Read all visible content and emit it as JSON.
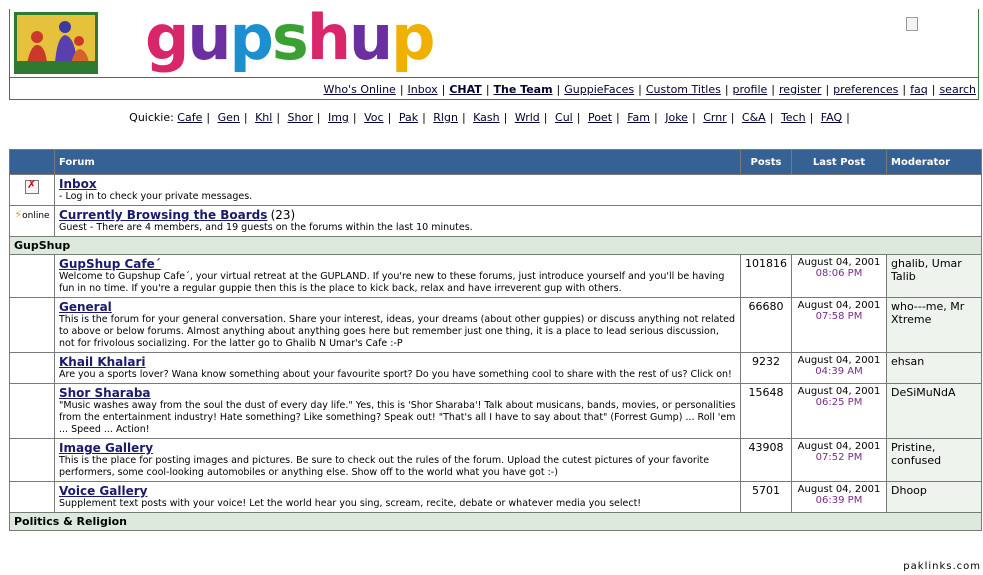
{
  "brand": {
    "name": "gupshup",
    "letter_colors": [
      "#d9266b",
      "#6c2fa0",
      "#1b8fd0",
      "#3aa033",
      "#d9266b",
      "#6c2fa0",
      "#f0b000"
    ]
  },
  "top_links": [
    {
      "label": "Who's Online",
      "bold": false
    },
    {
      "label": "Inbox",
      "bold": false
    },
    {
      "label": "CHAT",
      "bold": true
    },
    {
      "label": "The Team",
      "bold": true
    },
    {
      "label": "GuppieFaces",
      "bold": false
    },
    {
      "label": "Custom Titles",
      "bold": false
    },
    {
      "label": "profile",
      "bold": false
    },
    {
      "label": "register",
      "bold": false
    },
    {
      "label": "preferences",
      "bold": false
    },
    {
      "label": "faq",
      "bold": false
    },
    {
      "label": "search",
      "bold": false
    }
  ],
  "quickie": {
    "label": "Quickie:",
    "links": [
      "Cafe",
      "Gen",
      "Khl",
      "Shor",
      "Img",
      "Voc",
      "Pak",
      "Rlgn",
      "Kash",
      "Wrld",
      "Cul",
      "Poet",
      "Fam",
      "Joke",
      "Crnr",
      "C&A",
      "Tech",
      "FAQ"
    ]
  },
  "table": {
    "headers": {
      "forum": "Forum",
      "posts": "Posts",
      "last_post": "Last Post",
      "moderator": "Moderator"
    },
    "inbox": {
      "title": "Inbox",
      "desc": "- Log in to check your private messages."
    },
    "browsing": {
      "icon_label": "online",
      "title": "Currently Browsing the Boards",
      "count": "(23)",
      "desc": "Guest - There are 4 members, and 19 guests on the forums within the last 10 minutes."
    },
    "category1": "GupShup",
    "forums": [
      {
        "title": "GupShup Cafe´",
        "desc": "Welcome to Gupshup Cafe´, your virtual retreat at the GUPLAND. If you're new to these forums, just introduce yourself and you'll be having fun in no time. If you're a regular guppie then this is the place to kick back, relax and have irreverent gup with others.",
        "posts": "101816",
        "date": "August 04, 2001",
        "time": "08:06 PM",
        "mod": "ghalib, Umar Talib"
      },
      {
        "title": "General",
        "desc": "This is the forum for your general conversation. Share your interest, ideas, your dreams (about other guppies) or discuss anything not related to above or below forums. Almost anything about anything goes here but remember just one thing, it is a place to lead serious discussion, not for frivolous socializing. For the latter go to Ghalib N Umar's Cafe :-P",
        "posts": "66680",
        "date": "August 04, 2001",
        "time": "07:58 PM",
        "mod": "who---me, Mr Xtreme"
      },
      {
        "title": "Khail Khalari",
        "desc": "Are you a sports lover? Wana know something about your favourite sport? Do you have something cool to share with the rest of us? Click on!",
        "posts": "9232",
        "date": "August 04, 2001",
        "time": "04:39 AM",
        "mod": "ehsan"
      },
      {
        "title": "Shor Sharaba",
        "desc": "\"Music washes away from the soul the dust of every day life.\" Yes, this is 'Shor Sharaba'! Talk about musicans, bands, movies, or personalities from the entertainment industry! Hate something? Like something? Speak out! \"That's all I have to say about that\" (Forrest Gump) ... Roll 'em ... Speed ... Action!",
        "posts": "15648",
        "date": "August 04, 2001",
        "time": "06:25 PM",
        "mod": "DeSiMuNdA"
      },
      {
        "title": "Image Gallery",
        "desc": "This is the place for posting images and pictures. Be sure to check out the rules of the forum. Upload the cutest pictures of your favorite performers, some cool-looking automobiles or anything else. Show off to the world what you have got :-)",
        "posts": "43908",
        "date": "August 04, 2001",
        "time": "07:52 PM",
        "mod": "Pristine, confused"
      },
      {
        "title": "Voice Gallery",
        "desc": "Supplement text posts with your voice! Let the world hear you sing, scream, recite, debate or whatever media you select!",
        "posts": "5701",
        "date": "August 04, 2001",
        "time": "06:39 PM",
        "mod": "Dhoop"
      }
    ],
    "category2": "Politics & Religion"
  },
  "footer": "paklinks.com"
}
